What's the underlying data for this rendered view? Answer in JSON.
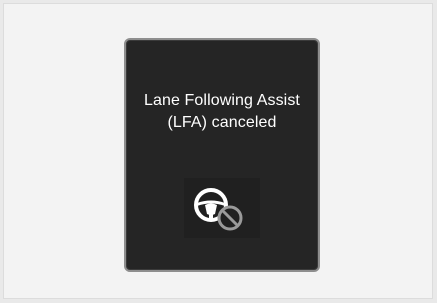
{
  "notification": {
    "line1": "Lane Following Assist",
    "line2": "(LFA) canceled",
    "icon": "steering-wheel-canceled-icon"
  },
  "colors": {
    "panel_background": "#252525",
    "panel_border": "#8e8e8e",
    "text": "#ffffff",
    "icon_wheel": "#ffffff",
    "icon_cancel": "#9a9a9a"
  }
}
